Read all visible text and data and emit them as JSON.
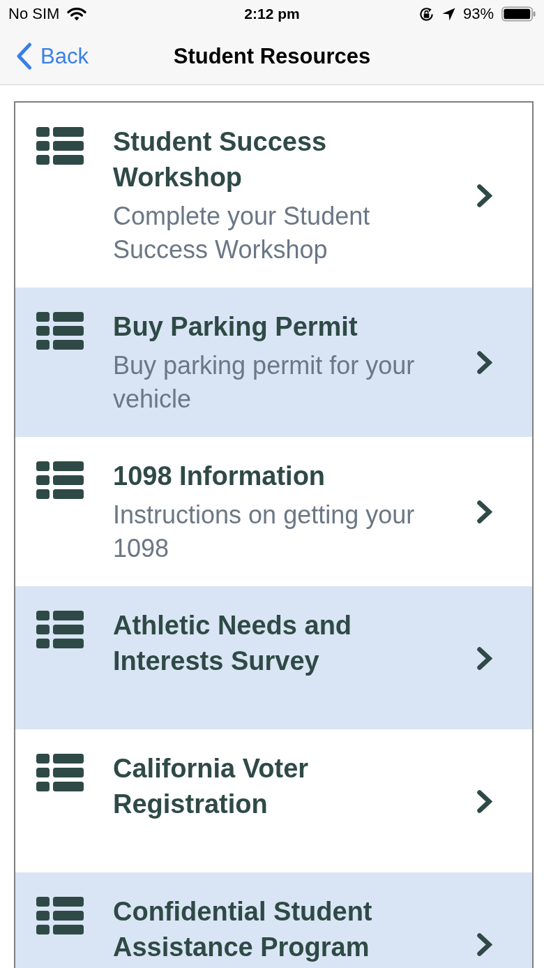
{
  "status_bar": {
    "carrier": "No SIM",
    "time": "2:12 pm",
    "battery": "93%"
  },
  "nav_bar": {
    "back": "Back",
    "title": "Student Resources"
  },
  "items": [
    {
      "title": "Student Success Workshop",
      "subtitle": "Complete your Student Success Workshop"
    },
    {
      "title": "Buy Parking Permit",
      "subtitle": "Buy parking permit for your vehicle"
    },
    {
      "title": "1098 Information",
      "subtitle": "Instructions on getting your 1098"
    },
    {
      "title": "Athletic Needs and Interests Survey"
    },
    {
      "title": "California Voter Registration"
    },
    {
      "title": "Confidential Student Assistance Program"
    }
  ]
}
